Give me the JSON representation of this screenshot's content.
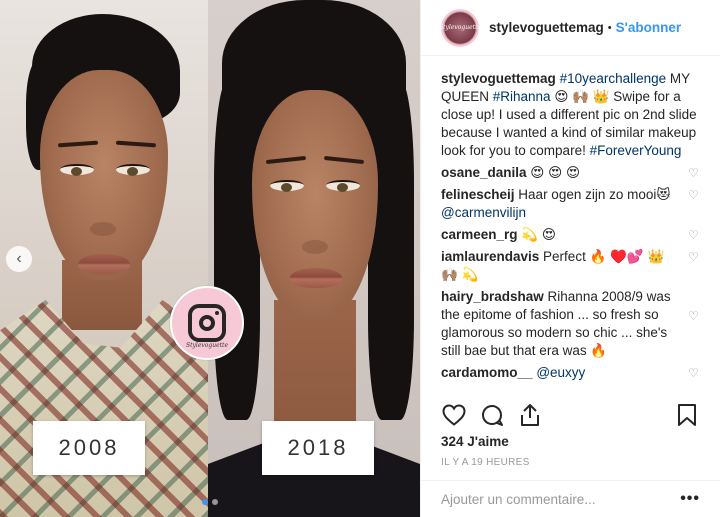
{
  "media": {
    "left_year": "2008",
    "right_year": "2018",
    "watermark_text": "Stylevoguette",
    "slide_count": 2,
    "active_slide": 1
  },
  "header": {
    "username": "stylevoguettemag",
    "separator": "•",
    "follow_label": "S'abonner",
    "avatar_text": "Stylevoguette"
  },
  "caption": {
    "username": "stylevoguettemag",
    "tag1": "#10yearchallenge",
    "text1": " MY QUEEN ",
    "tag2": "#Rihanna",
    "text2": " 😍 🙌🏽 👑  Swipe for a close up! I used a different pic on 2nd slide because I wanted a kind of similar makeup look for you to compare! ",
    "tag3": "#ForeverYoung"
  },
  "comments": [
    {
      "username": "osane_danila",
      "text": " 😍 😍 😍"
    },
    {
      "username": "felinescheij",
      "text": " Haar ogen zijn zo mooi😻 ",
      "mention": "@carmenvilijn"
    },
    {
      "username": "carmeen_rg",
      "text": " 💫 😍"
    },
    {
      "username": "iamlaurendavis",
      "text": " Perfect 🔥 ♥️💕 👑 🙌🏽 💫"
    },
    {
      "username": "hairy_bradshaw",
      "text": " Rihanna 2008/9 was the epitome of fashion ... so fresh so glamorous so modern so chic ... she's still bae but that era was 🔥"
    },
    {
      "username": "cardamomo__",
      "text": " ",
      "mention": "@euxyy"
    }
  ],
  "actions": {
    "like_icon": "heart-icon",
    "comment_icon": "comment-icon",
    "share_icon": "share-icon",
    "save_icon": "bookmark-icon"
  },
  "likes": "324 J'aime",
  "timestamp": "IL Y A 19 HEURES",
  "add_comment": {
    "placeholder": "Ajouter un commentaire...",
    "more_label": "•••"
  },
  "colors": {
    "link": "#003569",
    "follow": "#3897f0",
    "muted": "#999999"
  }
}
